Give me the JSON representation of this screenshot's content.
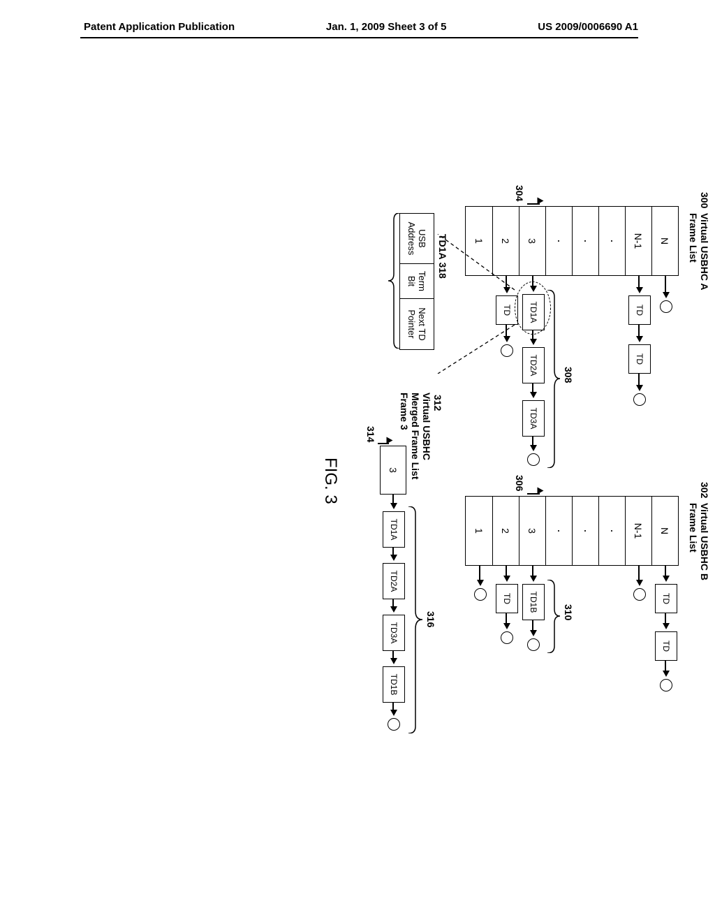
{
  "header": {
    "left": "Patent Application Publication",
    "mid": "Jan. 1, 2009  Sheet 3 of 5",
    "right": "US 2009/0006690 A1"
  },
  "labels": {
    "listA_ref": "300",
    "listA_title": "Virtual USBHC A\nFrame List",
    "listB_ref": "302",
    "listB_title": "Virtual USBHC B\nFrame List",
    "ptrA_ref": "304",
    "ptrB_ref": "306",
    "braceA_ref": "308",
    "braceB_ref": "310",
    "merged_ref": "312",
    "merged_title": "Virtual USBHC\nMerged Frame List\nFrame 3",
    "merged_ptr_ref": "314",
    "merged_brace_ref": "316",
    "td1a_label": "TD1A",
    "td1a_ref": "318",
    "fig": "FIG. 3"
  },
  "framerows": [
    "N",
    "N-1",
    "·",
    "·",
    "·",
    "3",
    "2",
    "1"
  ],
  "td": {
    "generic": "TD",
    "a1": "TD1A",
    "a2": "TD2A",
    "a3": "TD3A",
    "b1": "TD1B"
  },
  "td1a_cells": [
    "USB\nAddress",
    "Term\nBit",
    "Next TD\nPointer"
  ],
  "merged_row": "3"
}
